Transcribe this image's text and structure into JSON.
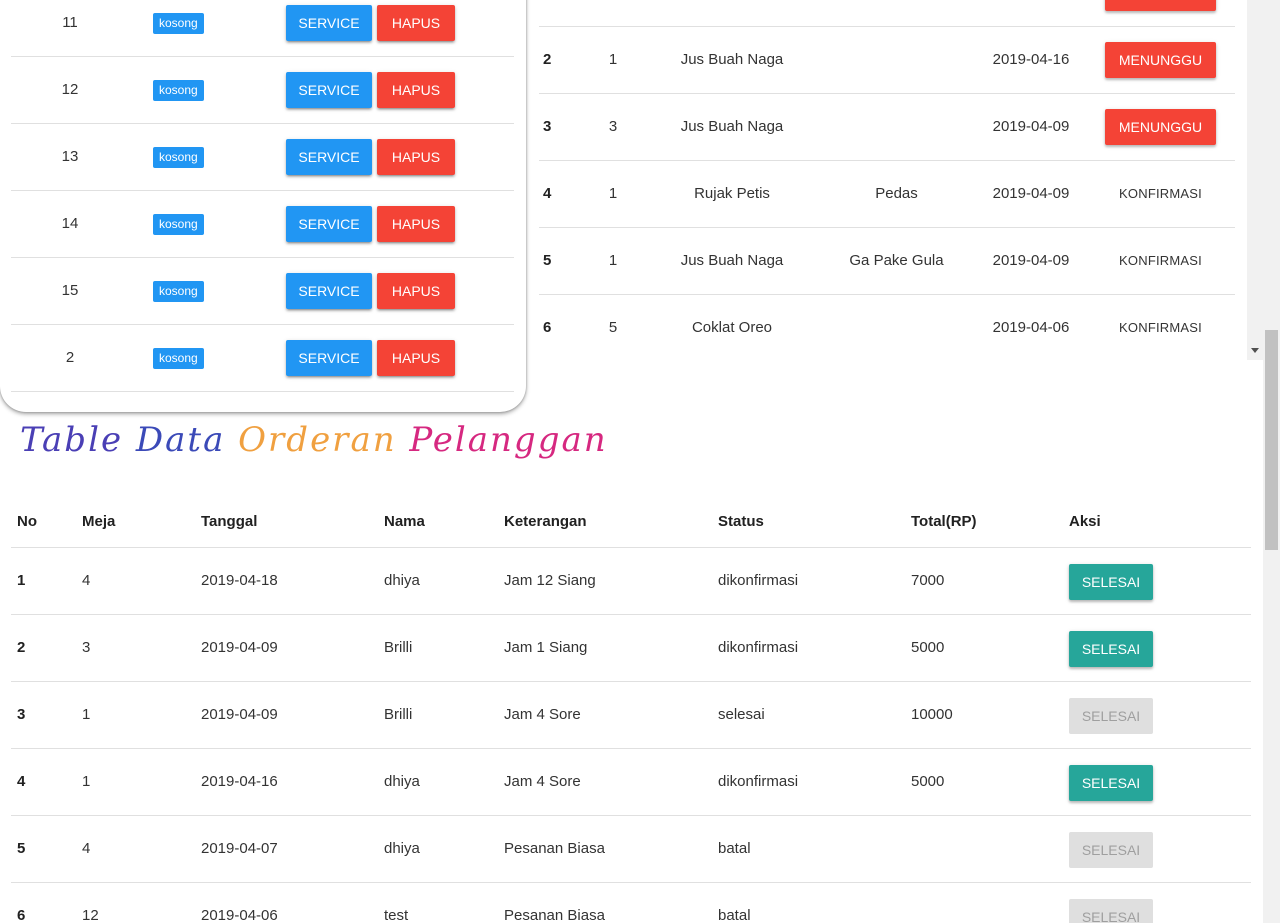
{
  "meja_table": {
    "rows": [
      {
        "no": "11",
        "status": "kosong",
        "service_label": "SERVICE",
        "hapus_label": "HAPUS"
      },
      {
        "no": "12",
        "status": "kosong",
        "service_label": "SERVICE",
        "hapus_label": "HAPUS"
      },
      {
        "no": "13",
        "status": "kosong",
        "service_label": "SERVICE",
        "hapus_label": "HAPUS"
      },
      {
        "no": "14",
        "status": "kosong",
        "service_label": "SERVICE",
        "hapus_label": "HAPUS"
      },
      {
        "no": "15",
        "status": "kosong",
        "service_label": "SERVICE",
        "hapus_label": "HAPUS"
      },
      {
        "no": "2",
        "status": "kosong",
        "service_label": "SERVICE",
        "hapus_label": "HAPUS"
      }
    ]
  },
  "pesanan_table": {
    "rows": [
      {
        "no": "",
        "jumlah": "",
        "menu": "",
        "keterangan": "",
        "tanggal": "",
        "status": "MENUNGGU",
        "status_type": "button"
      },
      {
        "no": "2",
        "jumlah": "1",
        "menu": "Jus Buah Naga",
        "keterangan": "",
        "tanggal": "2019-04-16",
        "status": "MENUNGGU",
        "status_type": "button"
      },
      {
        "no": "3",
        "jumlah": "3",
        "menu": "Jus Buah Naga",
        "keterangan": "",
        "tanggal": "2019-04-09",
        "status": "MENUNGGU",
        "status_type": "button"
      },
      {
        "no": "4",
        "jumlah": "1",
        "menu": "Rujak Petis",
        "keterangan": "Pedas",
        "tanggal": "2019-04-09",
        "status": "KONFIRMASI",
        "status_type": "flat"
      },
      {
        "no": "5",
        "jumlah": "1",
        "menu": "Jus Buah Naga",
        "keterangan": "Ga Pake Gula",
        "tanggal": "2019-04-09",
        "status": "KONFIRMASI",
        "status_type": "flat"
      },
      {
        "no": "6",
        "jumlah": "5",
        "menu": "Coklat Oreo",
        "keterangan": "",
        "tanggal": "2019-04-06",
        "status": "KONFIRMASI",
        "status_type": "flat"
      }
    ]
  },
  "orderan_section": {
    "title": "Table Data Orderan Pelanggan",
    "title_colors": [
      "#4a3fb5",
      "#3b4ab8",
      "#f0a040",
      "#d62880"
    ],
    "headers": {
      "no": "No",
      "meja": "Meja",
      "tanggal": "Tanggal",
      "nama": "Nama",
      "keterangan": "Keterangan",
      "status": "Status",
      "total": "Total(RP)",
      "aksi": "Aksi"
    },
    "rows": [
      {
        "no": "1",
        "meja": "4",
        "tanggal": "2019-04-18",
        "nama": "dhiya",
        "keterangan": "Jam 12 Siang",
        "status": "dikonfirmasi",
        "total": "7000",
        "aksi": "SELESAI",
        "aksi_enabled": true
      },
      {
        "no": "2",
        "meja": "3",
        "tanggal": "2019-04-09",
        "nama": "Brilli",
        "keterangan": "Jam 1 Siang",
        "status": "dikonfirmasi",
        "total": "5000",
        "aksi": "SELESAI",
        "aksi_enabled": true
      },
      {
        "no": "3",
        "meja": "1",
        "tanggal": "2019-04-09",
        "nama": "Brilli",
        "keterangan": "Jam 4 Sore",
        "status": "selesai",
        "total": "10000",
        "aksi": "SELESAI",
        "aksi_enabled": false
      },
      {
        "no": "4",
        "meja": "1",
        "tanggal": "2019-04-16",
        "nama": "dhiya",
        "keterangan": "Jam 4 Sore",
        "status": "dikonfirmasi",
        "total": "5000",
        "aksi": "SELESAI",
        "aksi_enabled": true
      },
      {
        "no": "5",
        "meja": "4",
        "tanggal": "2019-04-07",
        "nama": "dhiya",
        "keterangan": "Pesanan Biasa",
        "status": "batal",
        "total": "",
        "aksi": "SELESAI",
        "aksi_enabled": false
      },
      {
        "no": "6",
        "meja": "12",
        "tanggal": "2019-04-06",
        "nama": "test",
        "keterangan": "Pesanan Biasa",
        "status": "batal",
        "total": "",
        "aksi": "SELESAI",
        "aksi_enabled": false
      }
    ]
  },
  "colors": {
    "primary_blue": "#2196f3",
    "danger_red": "#f44336",
    "teal": "#26a69a",
    "disabled_grey": "#dfdfdf"
  },
  "icons": {
    "scroll_down": "chevron-down-icon"
  }
}
